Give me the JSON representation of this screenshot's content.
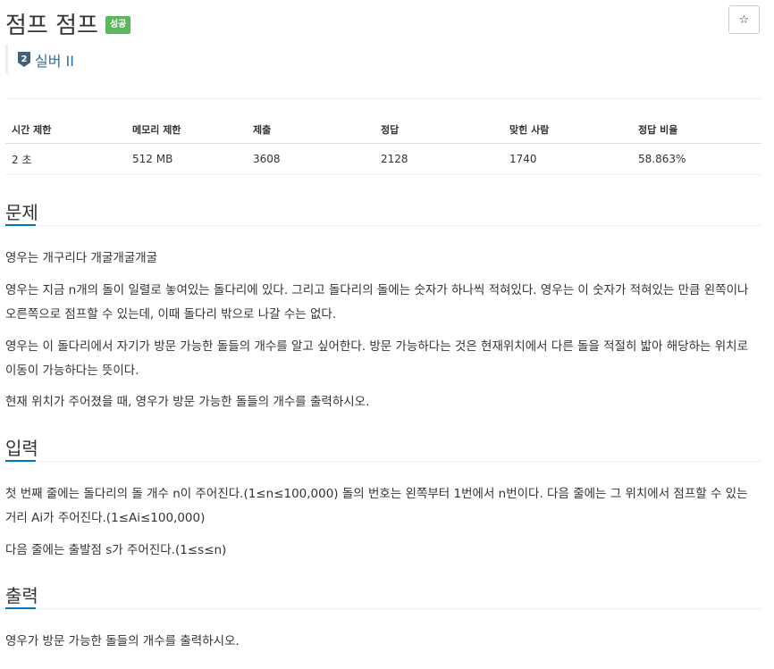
{
  "header": {
    "title": "점프 점프",
    "badge": "성공",
    "star_label": "☆",
    "tier_number": "2",
    "tier_label": "실버 II"
  },
  "info_table": {
    "headers": [
      "시간 제한",
      "메모리 제한",
      "제출",
      "정답",
      "맞힌 사람",
      "정답 비율"
    ],
    "row": [
      "2 초",
      "512 MB",
      "3608",
      "2128",
      "1740",
      "58.863%"
    ]
  },
  "sections": {
    "problem": {
      "title": "문제",
      "paragraphs": [
        "영우는 개구리다 개굴개굴개굴",
        "영우는 지금 n개의 돌이 일렬로 놓여있는 돌다리에 있다. 그리고 돌다리의 돌에는 숫자가 하나씩 적혀있다. 영우는 이 숫자가 적혀있는 만큼 왼쪽이나 오른쪽으로 점프할 수 있는데, 이때 돌다리 밖으로 나갈 수는 없다.",
        "영우는 이 돌다리에서 자기가 방문 가능한 돌들의 개수를 알고 싶어한다. 방문 가능하다는 것은 현재위치에서 다른 돌을 적절히 밟아 해당하는 위치로 이동이 가능하다는 뜻이다.",
        "현재 위치가 주어졌을 때, 영우가 방문 가능한 돌들의 개수를 출력하시오."
      ]
    },
    "input": {
      "title": "입력",
      "paragraphs": [
        "첫 번째 줄에는 돌다리의 돌 개수 n이 주어진다.(1≤n≤100,000) 돌의 번호는 왼쪽부터 1번에서 n번이다. 다음 줄에는 그 위치에서 점프할 수 있는 거리 Ai가 주어진다.(1≤Ai≤100,000)",
        "다음 줄에는 출발점 s가 주어진다.(1≤s≤n)"
      ]
    },
    "output": {
      "title": "출력",
      "paragraphs": [
        "영우가 방문 가능한 돌들의 개수를 출력하시오."
      ]
    }
  },
  "colors": {
    "badge_success": "#5cb85c",
    "tier_blue": "#2e6fa3",
    "section_underline": "#0076c0"
  }
}
